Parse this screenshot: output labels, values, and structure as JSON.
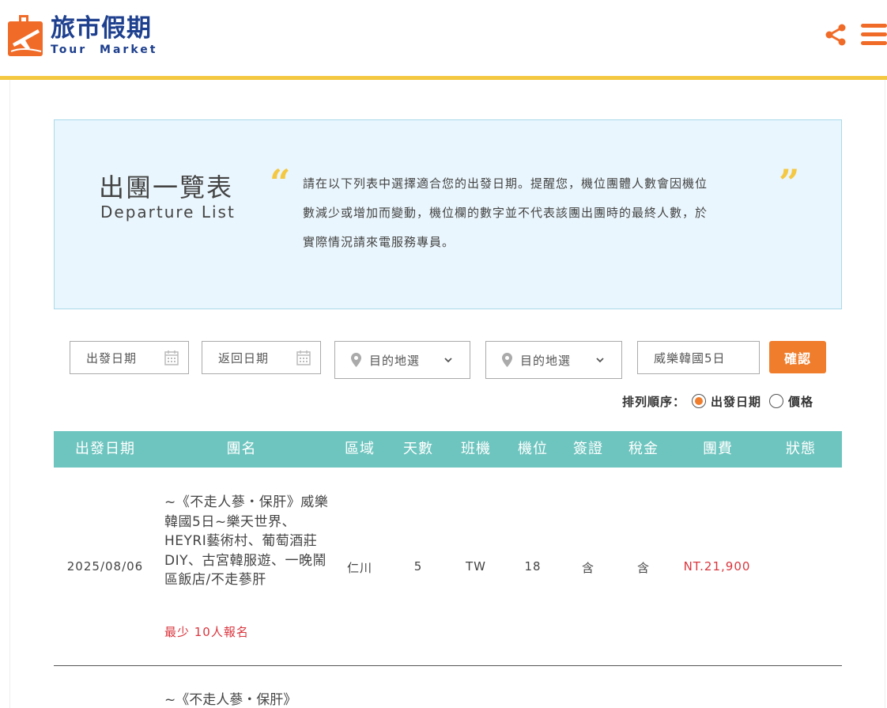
{
  "header": {
    "logo_cn": "旅市假期",
    "logo_en": "Tour Market",
    "colors": {
      "brand_blue": "#1d3f8e",
      "brand_orange": "#f06b28",
      "accent_yellow": "#f5c842"
    }
  },
  "intro": {
    "title_cn": "出團一覽表",
    "title_en": "Departure List",
    "quote_open": "“",
    "quote_close": "”",
    "lines": [
      "請在以下列表中選擇適合您的出發日期。提醒您，機位團體人數會因機位",
      "數減少或增加而變動，機位欄的數字並不代表該團出團時的最終人數，於",
      "實際情況請來電服務專員。"
    ]
  },
  "filters": {
    "depart_date_placeholder": "出發日期",
    "return_date_placeholder": "返回日期",
    "destination_1": "目的地選",
    "destination_2": "目的地選",
    "keyword_value": "威樂韓國5日",
    "confirm_label": "確認"
  },
  "sort": {
    "label": "排列順序：",
    "options": [
      {
        "label": "出發日期",
        "selected": true
      },
      {
        "label": "價格",
        "selected": false
      }
    ]
  },
  "table": {
    "headers": [
      "出發日期",
      "團名",
      "區域",
      "天數",
      "班機",
      "機位",
      "簽證",
      "稅金",
      "團費",
      "狀態"
    ],
    "rows": [
      {
        "date": "2025/08/06",
        "name": "~《不走人蔘・保肝》威樂韓國5日~樂天世界、HEYRI藝術村、葡萄酒莊DIY、古宮韓服遊、一晚鬧區飯店/不走蔘肝",
        "min_note": "最少 10人報名",
        "region": "仁川",
        "days": "5",
        "airline": "TW",
        "seats": "18",
        "visa": "含",
        "tax": "含",
        "price": "NT.21,900",
        "status": ""
      },
      {
        "name_partial": "~《不走人蔘・保肝》"
      }
    ]
  }
}
